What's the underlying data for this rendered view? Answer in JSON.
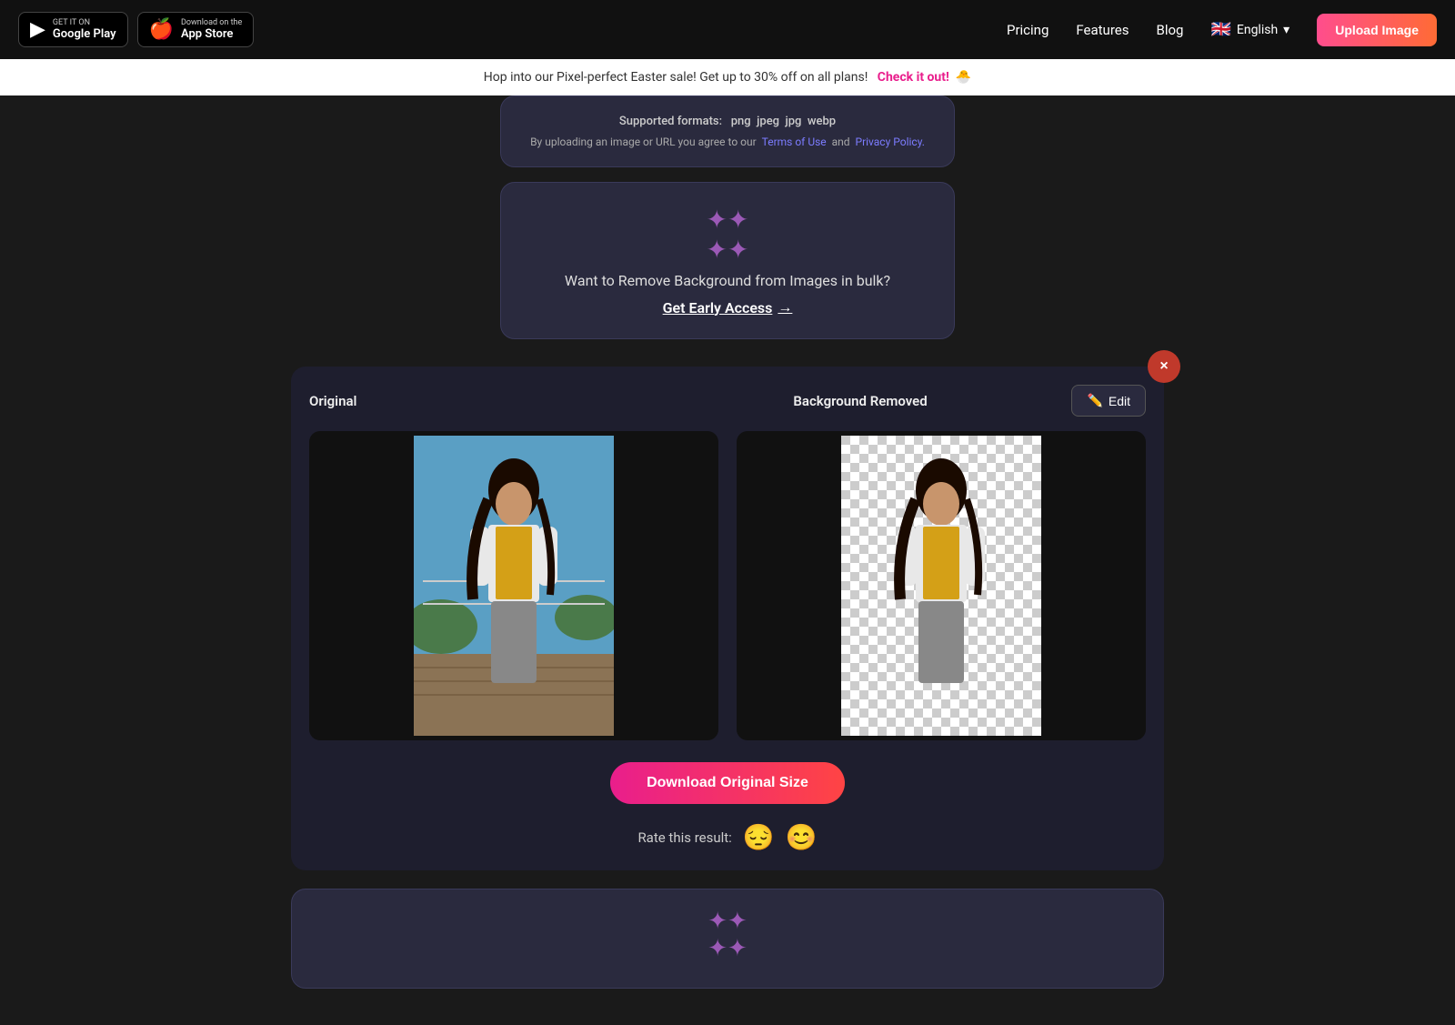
{
  "navbar": {
    "google_play_label_top": "GET IT ON",
    "google_play_label_bottom": "Google Play",
    "app_store_label_top": "Download on the",
    "app_store_label_bottom": "App Store",
    "pricing_label": "Pricing",
    "features_label": "Features",
    "blog_label": "Blog",
    "language": "English",
    "upload_button": "Upload Image"
  },
  "promo_banner": {
    "text": "Hop into our Pixel-perfect Easter sale! Get up to 30% off on all plans!",
    "cta": "Check it out!",
    "emoji": "🐣"
  },
  "top_card": {
    "supported_label": "Supported formats:",
    "formats": [
      "png",
      "jpeg",
      "jpg",
      "webp"
    ],
    "terms_text": "By uploading an image or URL you agree to our",
    "terms_link": "Terms of Use",
    "and_text": "and",
    "privacy_link": "Privacy Policy."
  },
  "bulk_card": {
    "icon": "✦",
    "title": "Want to Remove Background from Images in bulk?",
    "cta": "Get Early Access",
    "arrow": "→"
  },
  "results": {
    "original_label": "Original",
    "removed_label": "Background Removed",
    "edit_button": "Edit",
    "edit_icon": "✏️"
  },
  "download": {
    "button_label": "Download Original Size"
  },
  "rating": {
    "label": "Rate this result:",
    "sad_emoji": "😔",
    "happy_emoji": "😊"
  },
  "close_button": "×",
  "bottom_teaser": {
    "icon": "✦"
  }
}
